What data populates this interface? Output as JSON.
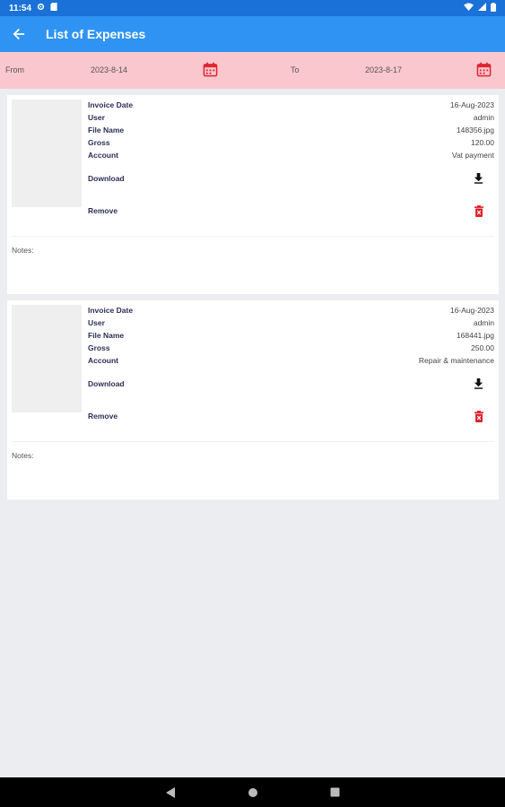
{
  "status": {
    "time": "11:54",
    "icons": [
      "gear-icon",
      "sim-card-icon",
      "wifi-icon",
      "signal-icon",
      "battery-icon"
    ]
  },
  "appbar": {
    "title": "List of Expenses",
    "back_icon": "arrow-left-icon"
  },
  "filters": {
    "from_label": "From",
    "from_value": "2023-8-14",
    "to_label": "To",
    "to_value": "2023-8-17",
    "calendar_icon": "calendar-icon",
    "accent_color": "#e0242f"
  },
  "expenses": [
    {
      "invoice_date_label": "Invoice Date",
      "invoice_date": "16-Aug-2023",
      "user_label": "User",
      "user": "admin",
      "file_name_label": "File Name",
      "file_name": "148356.jpg",
      "gross_label": "Gross",
      "gross": "120.00",
      "account_label": "Account",
      "account": "Vat payment",
      "download_label": "Download",
      "remove_label": "Remove",
      "notes_label": "Notes:"
    },
    {
      "invoice_date_label": "Invoice Date",
      "invoice_date": "16-Aug-2023",
      "user_label": "User",
      "user": "admin",
      "file_name_label": "File Name",
      "file_name": "168441.jpg",
      "gross_label": "Gross",
      "gross": "250.00",
      "account_label": "Account",
      "account": "Repair & maintenance",
      "download_label": "Download",
      "remove_label": "Remove",
      "notes_label": "Notes:"
    }
  ],
  "colors": {
    "appbar": "#2f93f3",
    "statusbar": "#1a72d8",
    "datebar": "#f9c7cd",
    "delete": "#e0242f"
  }
}
